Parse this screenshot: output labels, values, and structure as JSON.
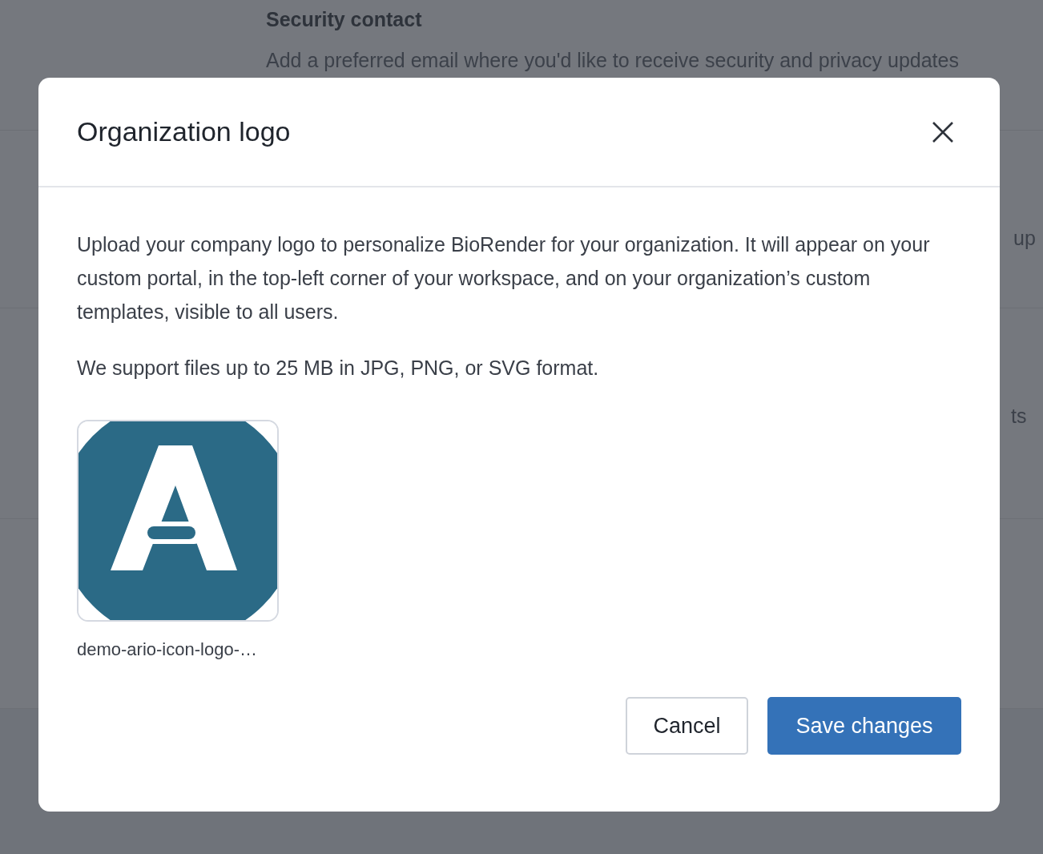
{
  "background": {
    "section_title": "Security contact",
    "section_description": "Add a preferred email where you'd like to receive security and privacy updates",
    "fragments": [
      {
        "right": "up"
      },
      {
        "right": "ts"
      }
    ]
  },
  "dialog": {
    "title": "Organization logo",
    "paragraphs": [
      "Upload your company logo to personalize BioRender for your organization. It will appear on your custom portal, in the top-left corner of your workspace, and on your organization’s custom templates, visible to all users.",
      "We support files up to 25 MB in JPG, PNG, or SVG format."
    ],
    "logo": {
      "kind": "picture",
      "filename": "demo-ario-icon-logo-…"
    },
    "buttons": [
      {
        "label": "Cancel",
        "kind": "secondary"
      },
      {
        "label": "Save changes",
        "kind": "primary"
      }
    ]
  }
}
